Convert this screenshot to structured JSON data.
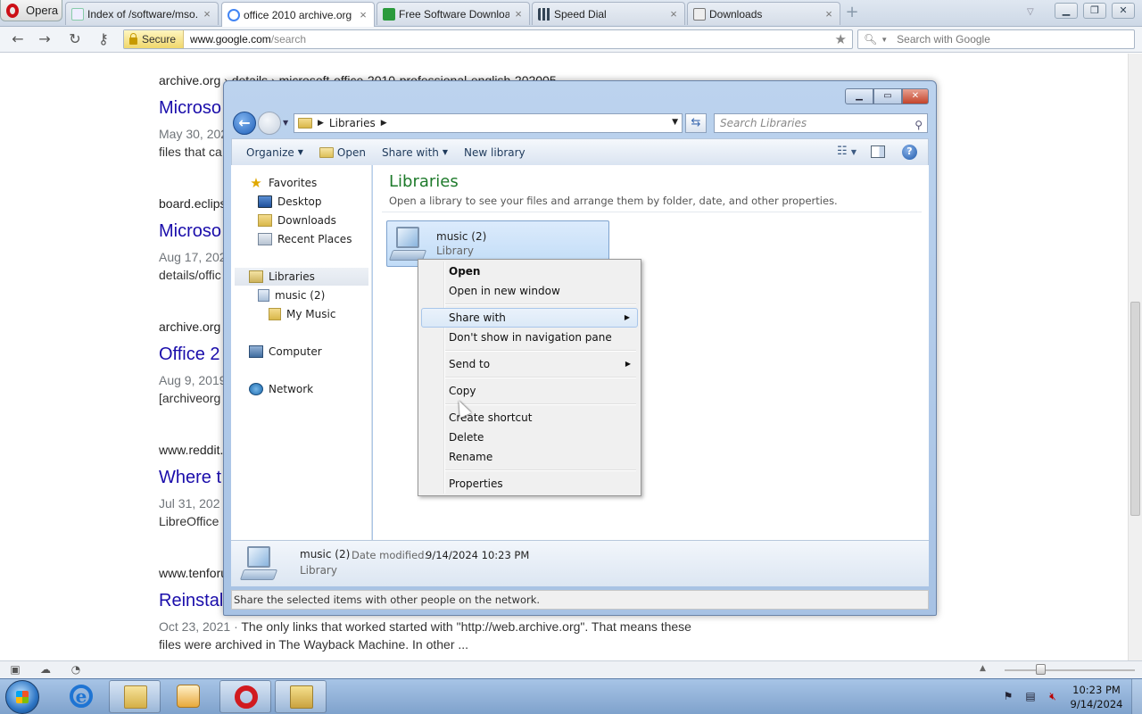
{
  "browser": {
    "menu_label": "Opera",
    "tabs": [
      {
        "label": "Index of /software/mso...",
        "icon": "folder-page-icon"
      },
      {
        "label": "office 2010 archive.org",
        "icon": "google-icon",
        "active": true
      },
      {
        "label": "Free Software Downloa...",
        "icon": "download-site-icon"
      },
      {
        "label": "Speed Dial",
        "icon": "speed-dial-icon"
      },
      {
        "label": "Downloads",
        "icon": "downloads-page-icon"
      }
    ],
    "tab_close_glyph": "×",
    "secure_label": "Secure",
    "url_host": "www.google.com",
    "url_path": "/search",
    "search_placeholder": "Search with Google"
  },
  "results": [
    {
      "url": "archive.org › details › microsoft-office-2010-professional-english-202005",
      "title": "Microso",
      "date": "May 30, 202",
      "snippet": "files that ca"
    },
    {
      "url": "board.eclips",
      "title": "Microso",
      "date": "Aug 17, 202",
      "snippet": "details/offic"
    },
    {
      "url": "archive.org",
      "title": "Office 2",
      "date": "Aug 9, 2019",
      "snippet": "[archiveorg"
    },
    {
      "url": "www.reddit.",
      "title": "Where t",
      "date": "Jul 31, 202",
      "snippet": "LibreOffice"
    },
    {
      "url": "www.tenforu",
      "title": "Reinstal",
      "date": "Oct 23, 2021",
      "snippet": "The only links that worked started with \"http://web.archive.org\". That means these",
      "snippet2": "files were archived in The Wayback Machine. In other ..."
    }
  ],
  "explorer": {
    "address_crumb": "Libraries",
    "search_placeholder": "Search Libraries",
    "commands": {
      "organize": "Organize",
      "open": "Open",
      "share_with": "Share with",
      "new_library": "New library"
    },
    "nav": {
      "favorites": "Favorites",
      "desktop": "Desktop",
      "downloads": "Downloads",
      "recent_places": "Recent Places",
      "libraries": "Libraries",
      "music2": "music (2)",
      "my_music": "My Music",
      "computer": "Computer",
      "network": "Network"
    },
    "content_title": "Libraries",
    "content_subtitle": "Open a library to see your files and arrange them by folder, date, and other properties.",
    "library_item": {
      "name": "music (2)",
      "type": "Library"
    },
    "details": {
      "name": "music (2)",
      "modified_label": "Date modified:",
      "modified_value": "9/14/2024 10:23 PM",
      "type": "Library"
    },
    "status": "Share the selected items with other people on the network."
  },
  "context_menu": {
    "open": "Open",
    "open_new_window": "Open in new window",
    "share_with": "Share with",
    "dont_show": "Don't show in navigation pane",
    "send_to": "Send to",
    "copy": "Copy",
    "create_shortcut": "Create shortcut",
    "delete": "Delete",
    "rename": "Rename",
    "properties": "Properties"
  },
  "taskbar": {
    "apps": [
      "internet-explorer",
      "windows-explorer",
      "media-player",
      "opera",
      "folder"
    ],
    "clock_time": "10:23 PM",
    "clock_date": "9/14/2024"
  }
}
